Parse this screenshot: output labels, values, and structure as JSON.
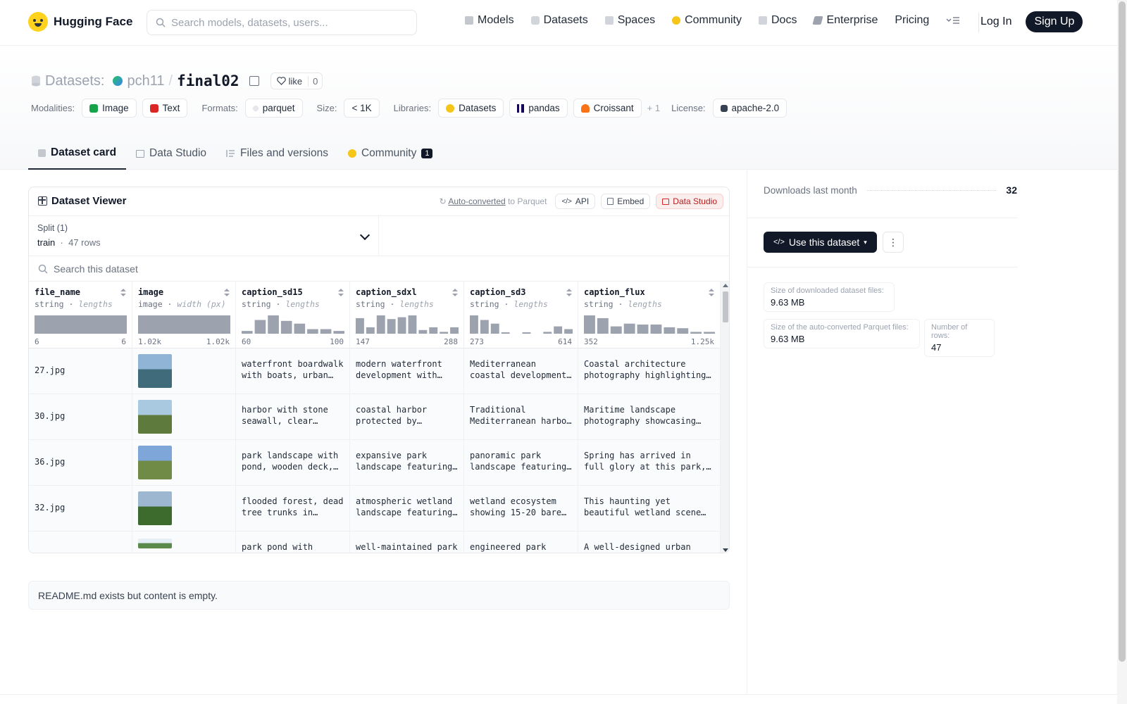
{
  "header": {
    "brand": "Hugging Face",
    "search_placeholder": "Search models, datasets, users...",
    "nav": [
      {
        "label": "Models",
        "icon": "cube-icon",
        "color": "#6b7280"
      },
      {
        "label": "Datasets",
        "icon": "database-icon",
        "color": "#9ca3af"
      },
      {
        "label": "Spaces",
        "icon": "grid-icon",
        "color": "#9ca3af"
      },
      {
        "label": "Community",
        "icon": "huggingface-icon",
        "color": "#f5c518"
      },
      {
        "label": "Docs",
        "icon": "book-icon",
        "color": "#9ca3af"
      },
      {
        "label": "Enterprise",
        "icon": "enterprise-icon",
        "color": "#6b7280"
      },
      {
        "label": "Pricing",
        "icon": "",
        "color": ""
      }
    ],
    "login": "Log In",
    "signup": "Sign Up"
  },
  "repo": {
    "section": "Datasets:",
    "owner": "pch11",
    "name": "final02",
    "like_label": "like",
    "like_count": "0"
  },
  "tags": {
    "modalities_label": "Modalities:",
    "modalities": [
      "Image",
      "Text"
    ],
    "formats_label": "Formats:",
    "formats": [
      "parquet"
    ],
    "size_label": "Size:",
    "size": "< 1K",
    "libraries_label": "Libraries:",
    "libraries": [
      "Datasets",
      "pandas",
      "Croissant"
    ],
    "libraries_more": "+ 1",
    "license_label": "License:",
    "license": "apache-2.0"
  },
  "tabs": [
    {
      "label": "Dataset card",
      "active": true
    },
    {
      "label": "Data Studio",
      "active": false
    },
    {
      "label": "Files and versions",
      "active": false
    },
    {
      "label": "Community",
      "active": false,
      "badge": "1"
    }
  ],
  "viewer": {
    "title": "Dataset Viewer",
    "auto_converted": "Auto-converted",
    "to_parquet": "to Parquet",
    "api": "API",
    "embed": "Embed",
    "data_studio": "Data Studio",
    "split_label": "Split (1)",
    "split_name": "train",
    "split_rows": "47 rows",
    "search_placeholder": "Search this dataset",
    "columns": [
      {
        "name": "file_name",
        "type": "string",
        "stat": "lengths",
        "min": "6",
        "max": "6",
        "hist": [
          1
        ]
      },
      {
        "name": "image",
        "type": "image",
        "stat": "width (px)",
        "min": "1.02k",
        "max": "1.02k",
        "hist": [
          1
        ]
      },
      {
        "name": "caption_sd15",
        "type": "string",
        "stat": "lengths",
        "min": "60",
        "max": "100",
        "hist": [
          0.15,
          0.75,
          1.0,
          0.7,
          0.55,
          0.25,
          0.25,
          0.15
        ]
      },
      {
        "name": "caption_sdxl",
        "type": "string",
        "stat": "lengths",
        "min": "147",
        "max": "288",
        "hist": [
          0.85,
          0.35,
          1.0,
          0.8,
          0.9,
          1.0,
          0.2,
          0.35,
          0.1,
          0.35
        ]
      },
      {
        "name": "caption_sd3",
        "type": "string",
        "stat": "lengths",
        "min": "273",
        "max": "614",
        "hist": [
          1.0,
          0.75,
          0.55,
          0.05,
          0.0,
          0.05,
          0.0,
          0.1,
          0.4,
          0.25
        ]
      },
      {
        "name": "caption_flux",
        "type": "string",
        "stat": "lengths",
        "min": "352",
        "max": "1.25k",
        "hist": [
          1.0,
          0.85,
          0.4,
          0.55,
          0.5,
          0.5,
          0.35,
          0.3,
          0.1,
          0.1
        ]
      }
    ],
    "rows": [
      {
        "file_name": "27.jpg",
        "thumb": [
          "#8fb4d6",
          "#3f6b7a"
        ],
        "captions": [
          "waterfront boardwalk with boats, urban…",
          "modern waterfront development with…",
          "Mediterranean coastal development…",
          "Coastal architecture photography highlighting…"
        ]
      },
      {
        "file_name": "30.jpg",
        "thumb": [
          "#a9c9e0",
          "#5e7a3c"
        ],
        "captions": [
          "harbor with stone seawall, clear…",
          "coastal harbor protected by…",
          "Traditional Mediterranean harbo…",
          "Maritime landscape photography showcasing…"
        ]
      },
      {
        "file_name": "36.jpg",
        "thumb": [
          "#7ea6d8",
          "#6f8b46"
        ],
        "captions": [
          "park landscape with pond, wooden deck,…",
          "expansive park landscape featuring…",
          "panoramic park landscape featuring…",
          "Spring has arrived in full glory at this park,…"
        ]
      },
      {
        "file_name": "32.jpg",
        "thumb": [
          "#9cb7cf",
          "#3d6b2e"
        ],
        "captions": [
          "flooded forest, dead tree trunks in…",
          "atmospheric wetland landscape featuring…",
          "wetland ecosystem showing 15-20 bare…",
          "This haunting yet beautiful wetland scene…"
        ]
      },
      {
        "file_name": "",
        "thumb": [
          "#e6eef5",
          "#5c8a4a"
        ],
        "captions": [
          "park pond with",
          "well-maintained park",
          "engineered park",
          "A well-designed urban"
        ]
      }
    ]
  },
  "readme": "README.md exists but content is empty.",
  "sidebar": {
    "downloads_label": "Downloads last month",
    "downloads_value": "32",
    "use_button": "Use this dataset",
    "stats": [
      {
        "label": "Size of downloaded dataset files:",
        "value": "9.63 MB"
      },
      {
        "label": "Size of the auto-converted Parquet files:",
        "value": "9.63 MB"
      },
      {
        "label": "Number of rows:",
        "value": "47"
      }
    ]
  },
  "colors": {
    "primary_dark": "#111827",
    "hist_bar": "#9ca3af",
    "data_studio_red": "#b91c1c"
  }
}
